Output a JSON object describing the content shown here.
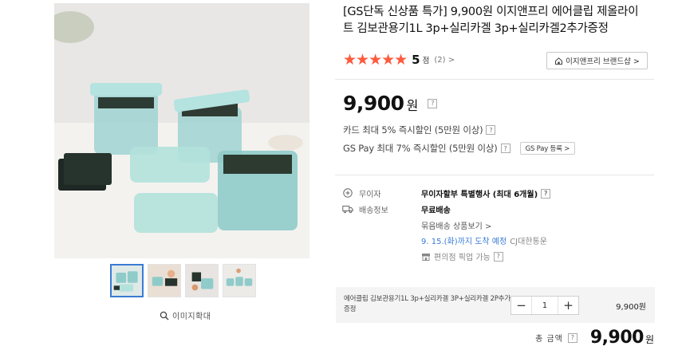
{
  "gallery": {
    "zoom_label": "이미지확대",
    "thumbnails": [
      "thumb-1",
      "thumb-2",
      "thumb-3",
      "thumb-4"
    ],
    "active_thumbnail": 0
  },
  "product": {
    "title": "[GS단독 신상품 특가] 9,900원 이지앤프리 에어클립 제올라이트 김보관용기1L 3p+실리카겔 3p+실리카겔2추가증정"
  },
  "rating": {
    "stars": "★★★★★",
    "score": "5",
    "unit": "점",
    "count": "(2) >"
  },
  "brand_shop": {
    "label": "이지앤프리 브랜드샵 >"
  },
  "price": {
    "amount": "9,900",
    "unit": "원"
  },
  "discounts": [
    {
      "text": "카드 최대 5% 즉시할인 (5만원 이상)"
    },
    {
      "text": "GS Pay 최대 7% 즉시할인 (5만원 이상)",
      "button": "GS Pay 등록 >"
    }
  ],
  "help_mark": "?",
  "info": {
    "interest_free": {
      "label": "무이자",
      "value": "무이자할부 특별행사 (최대 6개월)"
    },
    "shipping": {
      "label": "배송정보",
      "value": "무료배송",
      "bundle_link": "묶음배송 상품보기 >",
      "arrival_date": "9. 15.(화)까지 도착 예정",
      "arrival_place": "CJ대한통운",
      "pickup": "편의점 픽업 가능"
    }
  },
  "option": {
    "name": "에어클립 김보관용기1L 3p+실리카겔 3P+실리카겔 2P추가증정",
    "minus": "−",
    "quantity": "1",
    "plus": "+",
    "price": "9,900원"
  },
  "total": {
    "label": "총 금액",
    "amount": "9,900",
    "unit": "원"
  },
  "colors": {
    "star": "#ff5a3c",
    "delivery_date": "#3a7bd5",
    "active_thumb_border": "#3a7bd5",
    "option_bg": "#f4f4f5"
  }
}
